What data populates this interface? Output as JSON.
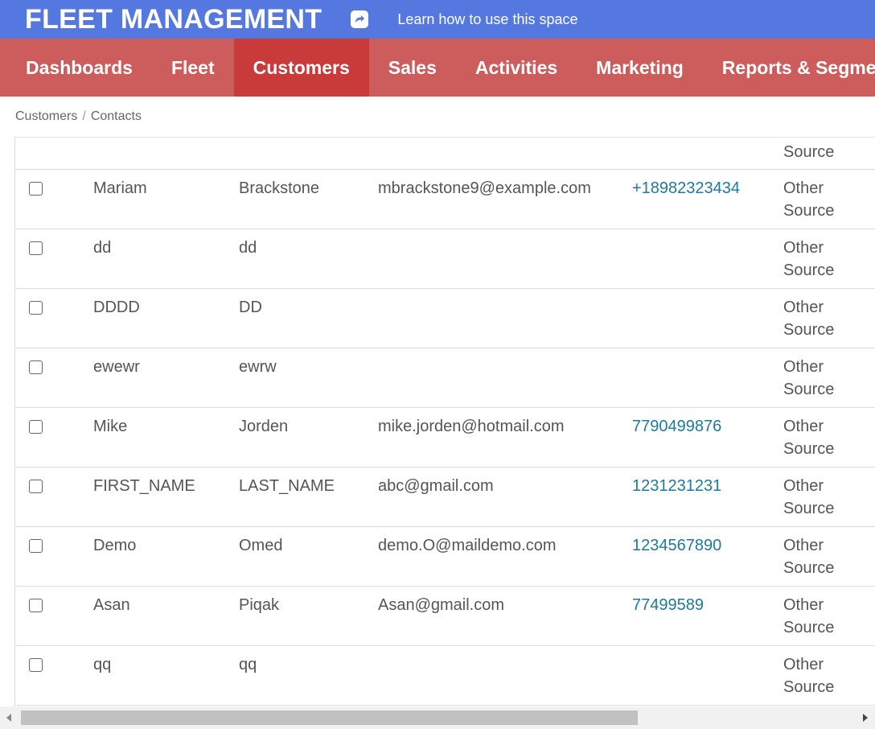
{
  "header": {
    "title": "FLEET MANAGEMENT",
    "learn_link": "Learn how to use this space"
  },
  "nav": {
    "items": [
      {
        "label": "Dashboards",
        "active": false
      },
      {
        "label": "Fleet",
        "active": false
      },
      {
        "label": "Customers",
        "active": true
      },
      {
        "label": "Sales",
        "active": false
      },
      {
        "label": "Activities",
        "active": false
      },
      {
        "label": "Marketing",
        "active": false
      },
      {
        "label": "Reports & Segments",
        "active": false
      }
    ]
  },
  "breadcrumb": {
    "items": [
      "Customers",
      "Contacts"
    ],
    "separator": "/"
  },
  "table": {
    "partial_row_source": "Source",
    "rows": [
      {
        "first": "Mariam",
        "last": "Brackstone",
        "email": "mbrackstone9@example.com",
        "phone": "+18982323434",
        "source_line1": "Other",
        "source_line2": "Source"
      },
      {
        "first": "dd",
        "last": "dd",
        "email": "",
        "phone": "",
        "source_line1": "Other",
        "source_line2": "Source"
      },
      {
        "first": "DDDD",
        "last": "DD",
        "email": "",
        "phone": "",
        "source_line1": "Other",
        "source_line2": "Source"
      },
      {
        "first": "ewewr",
        "last": "ewrw",
        "email": "",
        "phone": "",
        "source_line1": "Other",
        "source_line2": "Source"
      },
      {
        "first": "Mike",
        "last": "Jorden",
        "email": "mike.jorden@hotmail.com",
        "phone": "7790499876",
        "source_line1": "Other",
        "source_line2": "Source"
      },
      {
        "first": "FIRST_NAME",
        "last": "LAST_NAME",
        "email": "abc@gmail.com",
        "phone": "1231231231",
        "source_line1": "Other",
        "source_line2": "Source"
      },
      {
        "first": "Demo",
        "last": "Omed",
        "email": "demo.O@maildemo.com",
        "phone": "1234567890",
        "source_line1": "Other",
        "source_line2": "Source"
      },
      {
        "first": "Asan",
        "last": "Piqak",
        "email": "Asan@gmail.com",
        "phone": "77499589",
        "source_line1": "Other",
        "source_line2": "Source"
      },
      {
        "first": "qq",
        "last": "qq",
        "email": "",
        "phone": "",
        "source_line1": "Other",
        "source_line2": "Source"
      }
    ]
  },
  "colors": {
    "topbar": "#5577e0",
    "navbar": "#cd5c5c",
    "nav_active": "#c93a3a",
    "phone_link": "#1d7a9c"
  },
  "icons": {
    "share": "share-icon"
  }
}
